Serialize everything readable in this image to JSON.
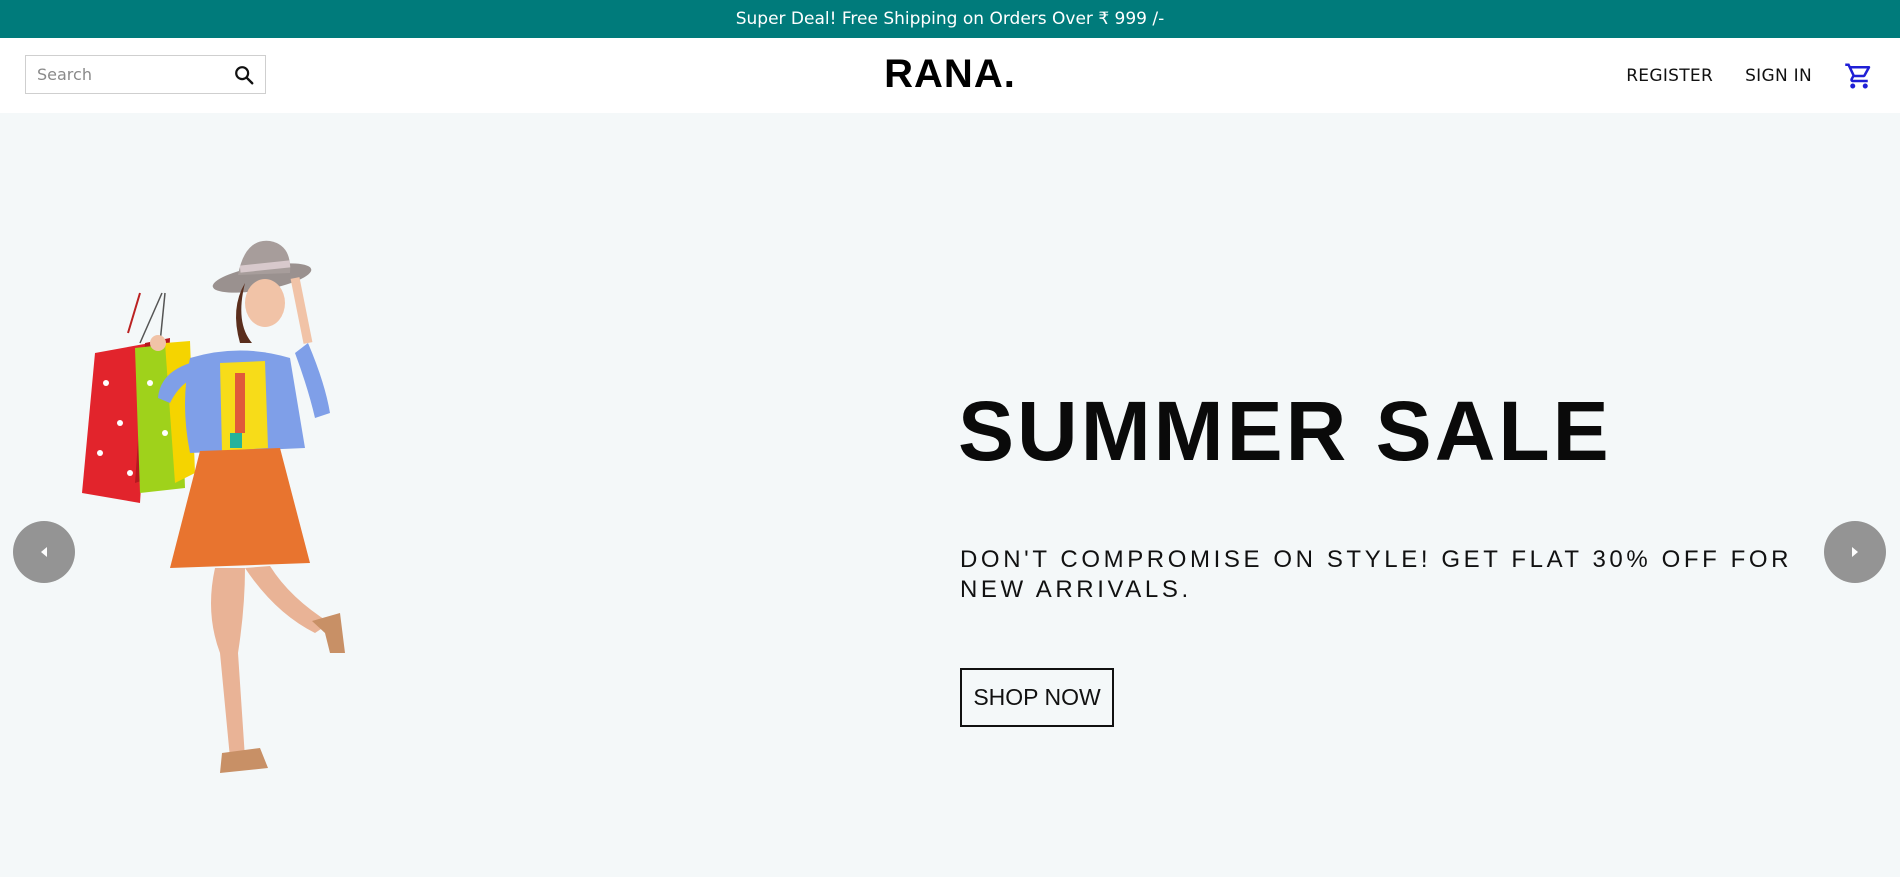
{
  "announcement": {
    "text": "Super Deal! Free Shipping on Orders Over ₹ 999 /-"
  },
  "navbar": {
    "search": {
      "placeholder": "Search",
      "value": ""
    },
    "logo": "RANA.",
    "links": {
      "register": "REGISTER",
      "sign_in": "SIGN IN"
    },
    "icons": {
      "search": "search-icon",
      "cart": "shopping-cart-icon"
    }
  },
  "colors": {
    "announcement_bg": "#007b7b",
    "hero_bg": "#f4f8f9",
    "cart_icon": "#1f1fd6",
    "arrow_bg": "#8f8f8f"
  },
  "slider": {
    "title": "SUMMER SALE",
    "description": "DON'T COMPROMISE ON STYLE! GET FLAT 30% OFF FOR NEW ARRIVALS.",
    "button_label": "SHOP NOW",
    "image": "woman-with-shopping-bags",
    "icons": {
      "prev": "chevron-left-icon",
      "next": "chevron-right-icon"
    }
  }
}
